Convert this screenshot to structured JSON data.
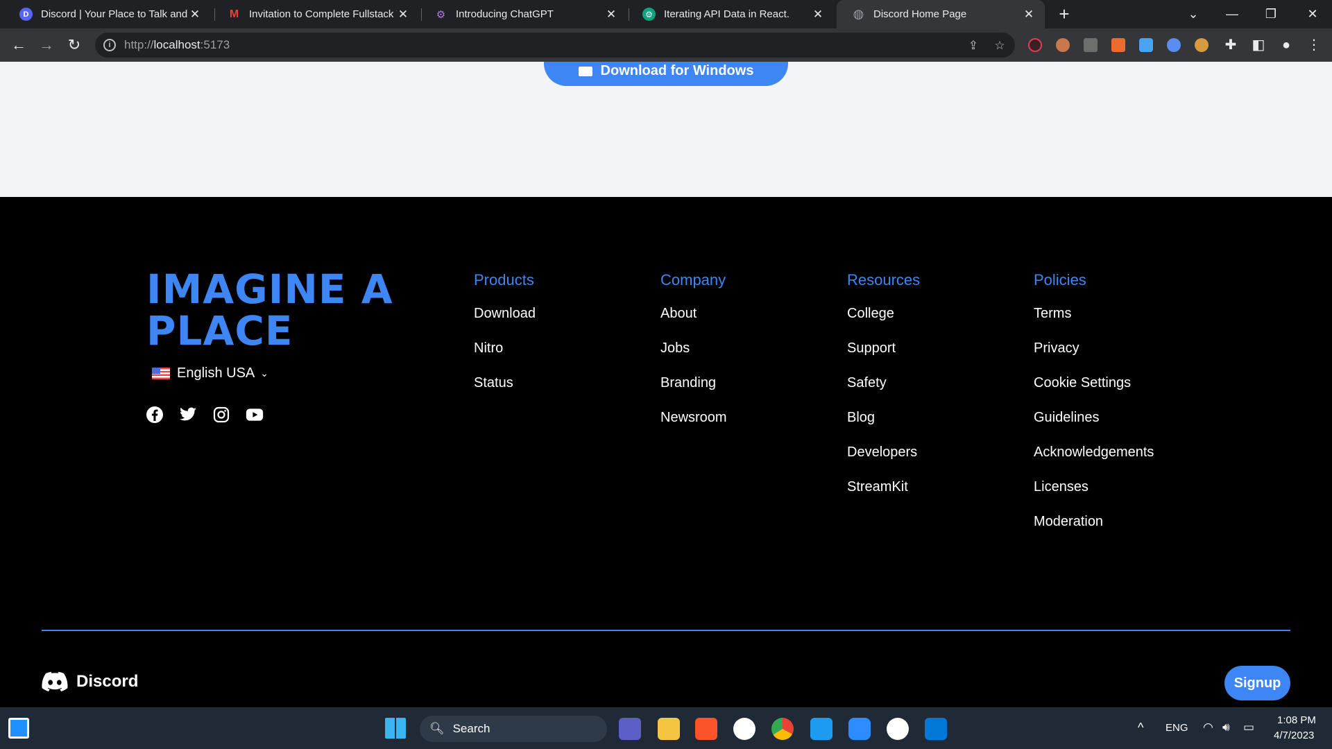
{
  "browser": {
    "tabs": [
      {
        "title": "Discord | Your Place to Talk and Hang Out",
        "favicon_color": "#5865f2",
        "favicon": "D"
      },
      {
        "title": "Invitation to Complete Fullstack Task",
        "favicon_color": "#ea4335",
        "favicon": "M"
      },
      {
        "title": "Introducing ChatGPT",
        "favicon_color": "#7a5aa6",
        "favicon": "⚙"
      },
      {
        "title": "Iterating API Data in React.",
        "favicon_color": "#10a37f",
        "favicon": "⚙"
      },
      {
        "title": "Discord Home Page",
        "favicon_color": "#9aa0a6",
        "favicon": "◍"
      }
    ],
    "url_prefix": "http://",
    "url_host": "localhost",
    "url_port": ":5173"
  },
  "page": {
    "download_button": "Download for Windows",
    "slogan": "IMAGINE A PLACE",
    "language": "English USA",
    "columns": [
      {
        "heading": "Products",
        "links": [
          "Download",
          "Nitro",
          "Status"
        ]
      },
      {
        "heading": "Company",
        "links": [
          "About",
          "Jobs",
          "Branding",
          "Newsroom"
        ]
      },
      {
        "heading": "Resources",
        "links": [
          "College",
          "Support",
          "Safety",
          "Blog",
          "Developers",
          "StreamKit"
        ]
      },
      {
        "heading": "Policies",
        "links": [
          "Terms",
          "Privacy",
          "Cookie Settings",
          "Guidelines",
          "Acknowledgements",
          "Licenses",
          "Moderation"
        ]
      }
    ],
    "brand": "Discord",
    "signup": "Signup",
    "accent": "#3d86f4"
  },
  "taskbar": {
    "search": "Search",
    "language": "ENG",
    "time": "1:08 PM",
    "date": "4/7/2023"
  }
}
